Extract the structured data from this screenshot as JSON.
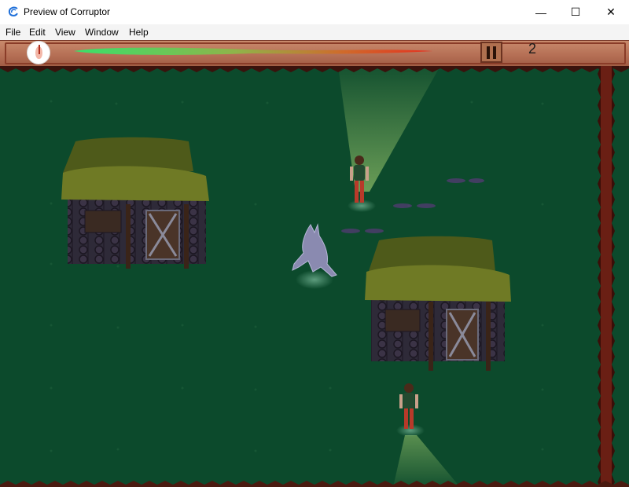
{
  "window": {
    "title": "Preview of Corruptor",
    "minimize_glyph": "—",
    "maximize_glyph": "☐",
    "close_glyph": "✕"
  },
  "menu": {
    "items": [
      "File",
      "Edit",
      "View",
      "Window",
      "Help"
    ]
  },
  "hud": {
    "score": "2",
    "health_fraction": 0.98,
    "icons": [
      "timer-dial-icon",
      "pause-icon"
    ]
  },
  "colors": {
    "grass": "#0c4a2c",
    "hud": "#b46e54",
    "health_start": "#39e06a",
    "health_end": "#e53020",
    "thorn": "#6a1f14"
  },
  "scene": {
    "huts": 2,
    "villagers": 2,
    "player": "ghost-creature"
  }
}
